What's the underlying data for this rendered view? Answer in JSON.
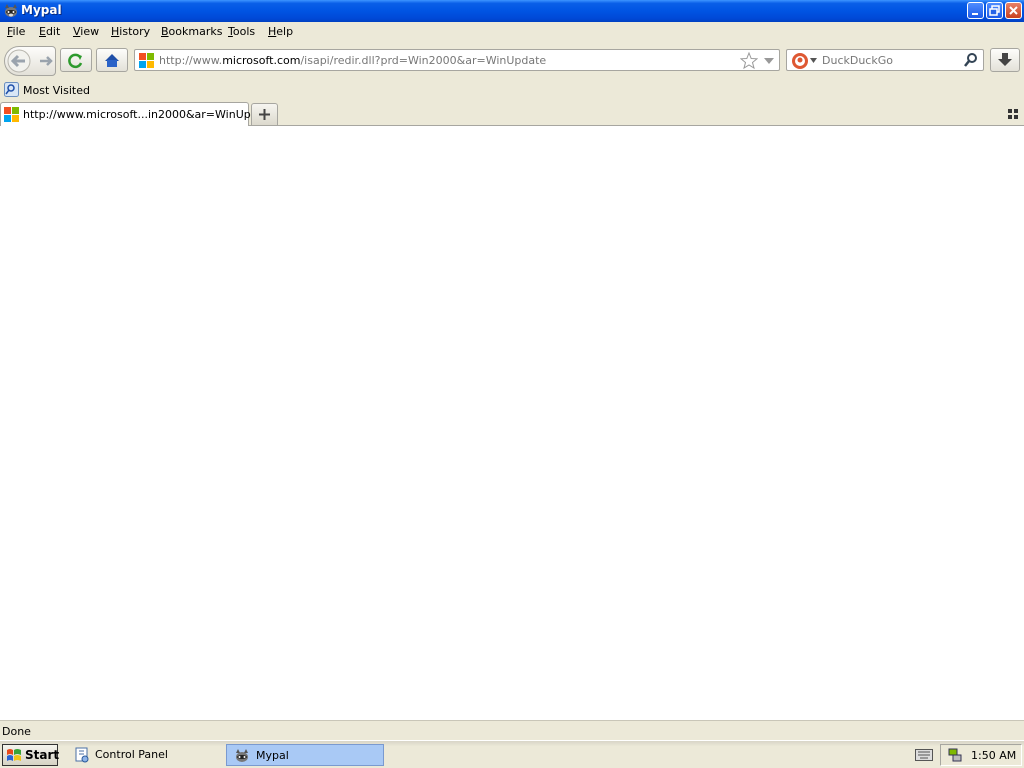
{
  "window": {
    "title": "Mypal"
  },
  "menu": {
    "items": [
      {
        "label": "File",
        "key": "F",
        "rest": "ile"
      },
      {
        "label": "Edit",
        "key": "E",
        "rest": "dit"
      },
      {
        "label": "View",
        "key": "V",
        "rest": "iew"
      },
      {
        "label": "History",
        "key": "H",
        "rest": "istory"
      },
      {
        "label": "Bookmarks",
        "key": "B",
        "rest": "ookmarks"
      },
      {
        "label": "Tools",
        "key": "T",
        "rest": "ools"
      },
      {
        "label": "Help",
        "key": "H",
        "rest": "elp"
      }
    ]
  },
  "navbar": {
    "url_prefix": "http://www.",
    "url_host": "microsoft.com",
    "url_rest": "/isapi/redir.dll?prd=Win2000&ar=WinUpdate",
    "search_engine": "DuckDuckGo"
  },
  "bookmarks": {
    "items": [
      {
        "label": "Most Visited"
      }
    ]
  },
  "tabs": [
    {
      "title": "http://www.microsoft...in2000&ar=WinUpdate"
    }
  ],
  "status": {
    "text": "Done"
  },
  "taskbar": {
    "start_label": "Start",
    "tasks": [
      {
        "label": "Control Panel",
        "active": false
      },
      {
        "label": "Mypal",
        "active": true
      }
    ],
    "clock": "1:50 AM"
  },
  "colors": {
    "titlebar": "#0054e3",
    "accent": "#3d95ff"
  },
  "icons": [
    "mypal-raccoon-icon",
    "minimize-icon",
    "restore-icon",
    "close-icon",
    "back-arrow-icon",
    "forward-arrow-icon",
    "reload-icon",
    "home-icon",
    "microsoft-favicon",
    "bookmark-star-icon",
    "dropdown-arrow-icon",
    "duckduckgo-icon",
    "search-icon",
    "download-icon",
    "bookmarks-folder-icon",
    "new-tab-plus-icon",
    "tab-list-icon",
    "windows-flag-icon",
    "control-panel-icon",
    "keyboard-icon",
    "network-tray-icon"
  ]
}
